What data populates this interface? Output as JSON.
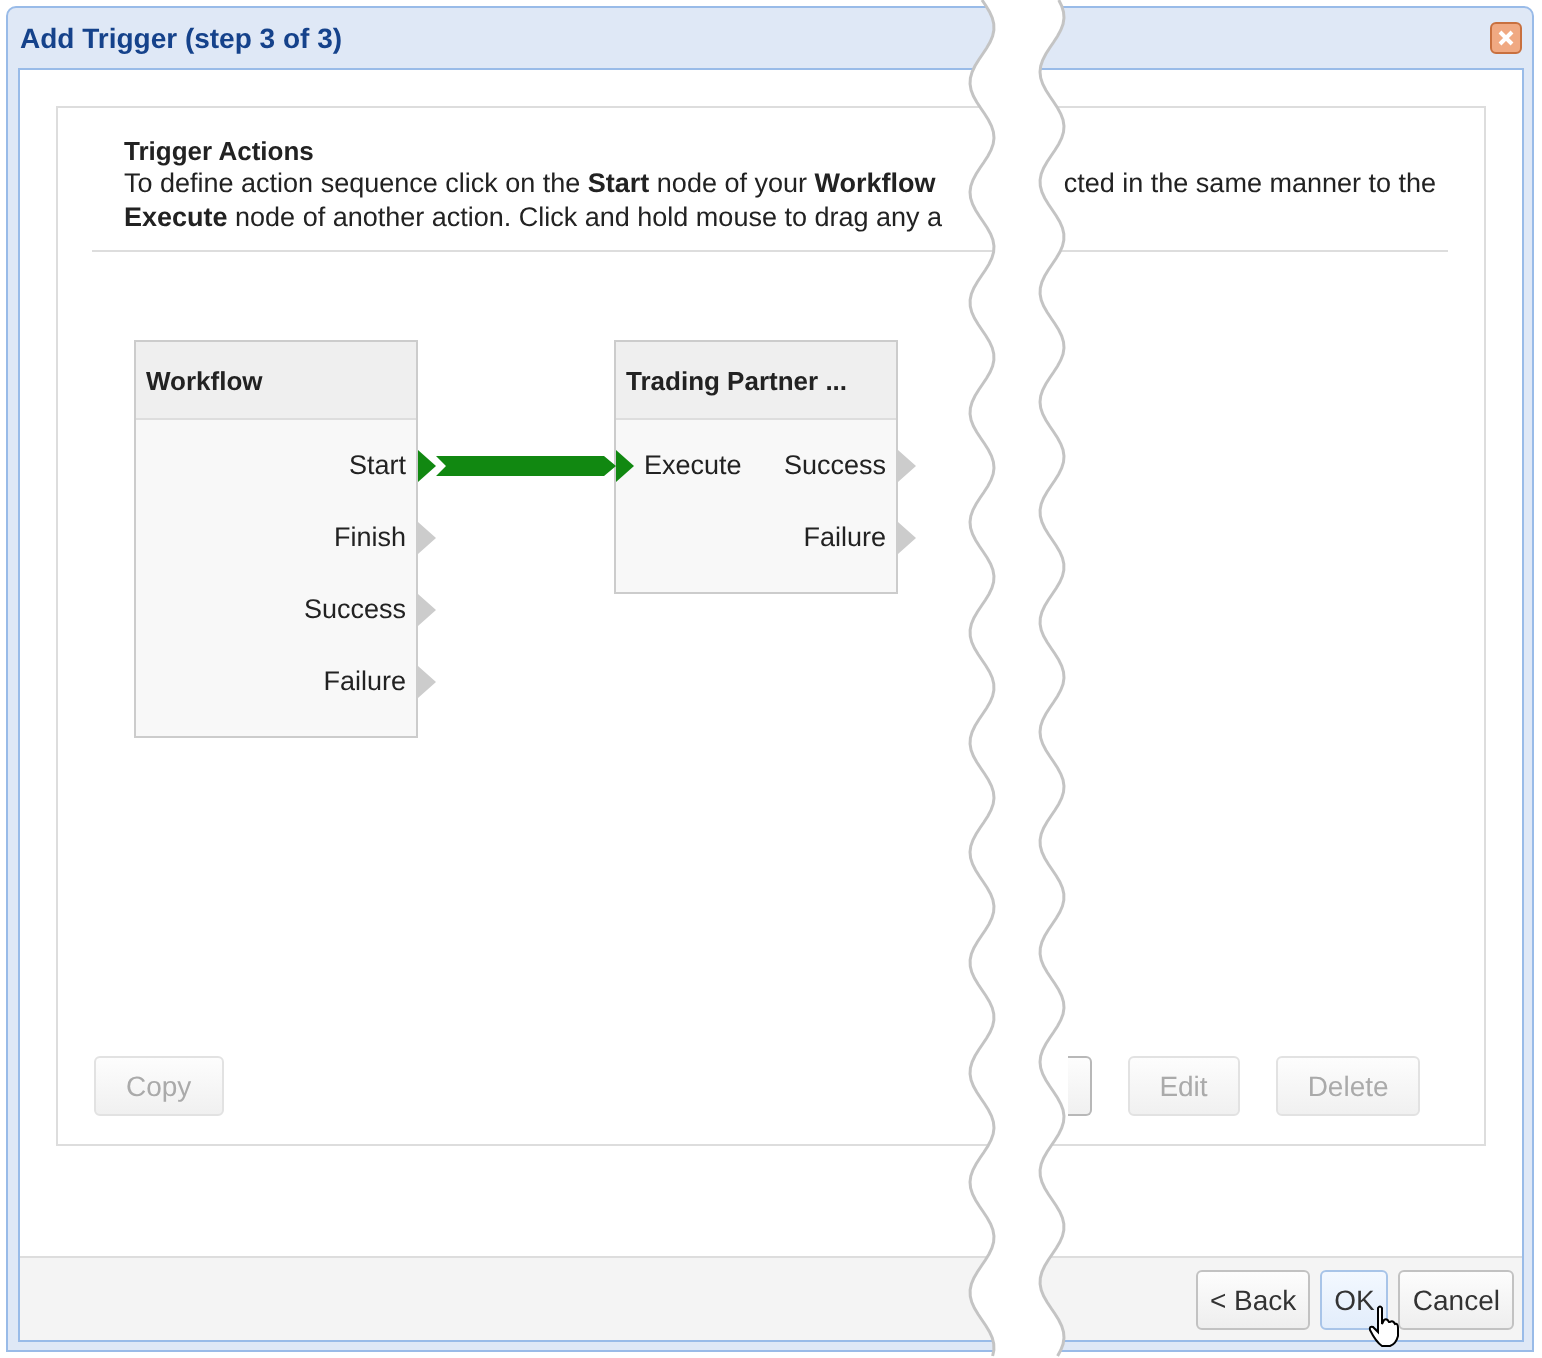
{
  "window": {
    "title": "Add Trigger (step 3 of 3)"
  },
  "section": {
    "title": "Trigger Actions",
    "description_left": [
      "To define action sequence click on the **Start** node of your **Workflow**",
      "**Execute** node of another action. Click and hold mouse to drag any a"
    ],
    "description_right": "cted in the same manner to the"
  },
  "nodes": [
    {
      "title": "Workflow",
      "outputs": [
        {
          "label": "Start",
          "connected": true
        },
        {
          "label": "Finish",
          "connected": false
        },
        {
          "label": "Success",
          "connected": false
        },
        {
          "label": "Failure",
          "connected": false
        }
      ]
    },
    {
      "title": "Trading Partner ...",
      "inputs": [
        {
          "label": "Execute",
          "connected": true
        }
      ],
      "outputs": [
        {
          "label": "Success",
          "connected": false
        },
        {
          "label": "Failure",
          "connected": false
        }
      ]
    }
  ],
  "action_buttons": [
    {
      "kind": "labeled",
      "label": "Copy",
      "disabled": true
    },
    {
      "kind": "cut",
      "disabled": false
    },
    {
      "kind": "labeled",
      "label": "Edit",
      "disabled": true
    },
    {
      "kind": "labeled",
      "label": "Delete",
      "disabled": true
    }
  ],
  "footer_buttons": [
    {
      "label": "< Back",
      "selected": false
    },
    {
      "label": "OK",
      "selected": true
    },
    {
      "label": "Cancel",
      "selected": false
    }
  ]
}
